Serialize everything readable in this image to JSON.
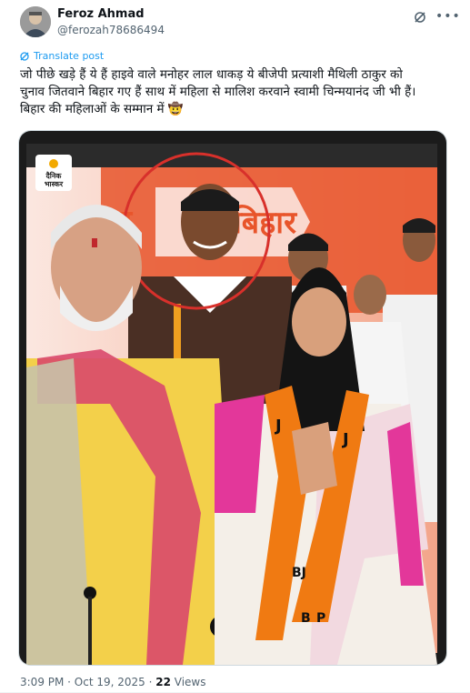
{
  "author": {
    "name": "Feroz Ahmad",
    "handle": "@ferozah78686494"
  },
  "translate_label": "Translate post",
  "post": {
    "lines": [
      "जो पीछे खड़े हैं ये हैं हाइवे वाले मनोहर लाल धाकड़ ये बीजेपी प्रत्याशी मैथिली ठाकुर को",
      "चुनाव जितवाने बिहार गए हैं साथ में महिला से मालिश करवाने स्वामी चिन्मयानंद जी भी हैं।",
      "बिहार की महिलाओं के सम्मान में 🤠"
    ]
  },
  "image": {
    "logo_line1": "दैनिक",
    "logo_line2": "भास्कर",
    "banner_text_left": "ड़",
    "banner_text_right": "बिहार",
    "scarf_letters": [
      "J",
      "J",
      "BJ",
      "B",
      "P"
    ]
  },
  "meta": {
    "time": "3:09 PM · Oct 19, 2025 · ",
    "views_count": "22",
    "views_label": " Views"
  },
  "colors": {
    "link": "#1d9bf0",
    "muted": "#536471",
    "banner": "#e8552b",
    "kurta": "#f3d04a",
    "saree_pink": "#e3379a",
    "scarf_orange": "#f07a12",
    "circle": "#d8302b"
  }
}
